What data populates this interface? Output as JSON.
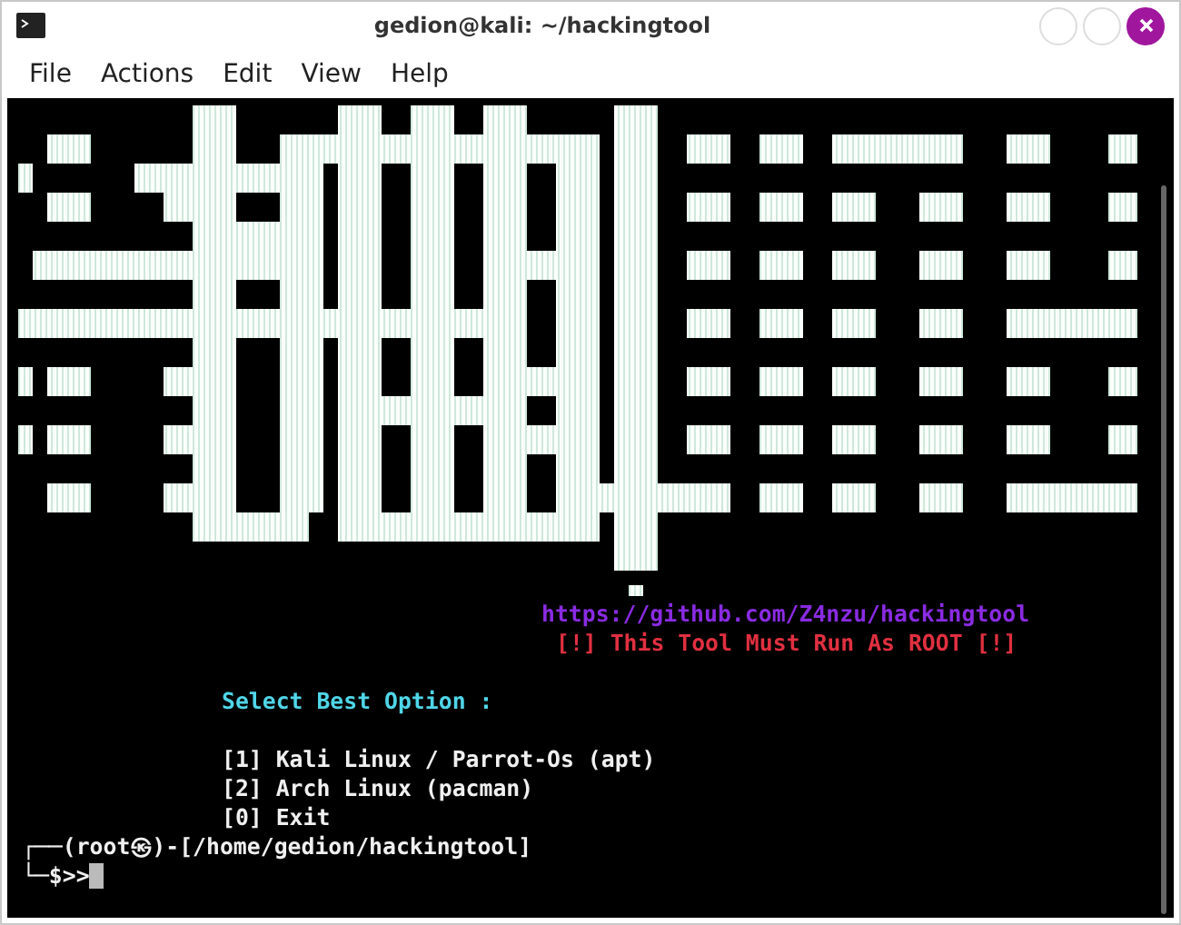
{
  "window": {
    "title": "gedion@kali: ~/hackingtool"
  },
  "menu": [
    "File",
    "Actions",
    "Edit",
    "View",
    "Help"
  ],
  "terminal": {
    "lines": [
      {
        "kind": "link",
        "text": "https://github.com/Z4nzu/hackingtool"
      },
      {
        "kind": "warning",
        "text": "[!] This Tool Must Run As ROOT [!]"
      },
      {
        "kind": "heading",
        "text": "Select Best Option :"
      },
      {
        "kind": "option",
        "text": "[1] Kali Linux / Parrot-Os (apt)"
      },
      {
        "kind": "option",
        "text": "[2] Arch Linux (pacman)"
      },
      {
        "kind": "option",
        "text": "[0] Exit"
      },
      {
        "kind": "prompt",
        "text": "┌──(root㉿)-[/home/gedion/hackingtool]"
      },
      {
        "kind": "input",
        "text": "└─$>>"
      }
    ]
  }
}
